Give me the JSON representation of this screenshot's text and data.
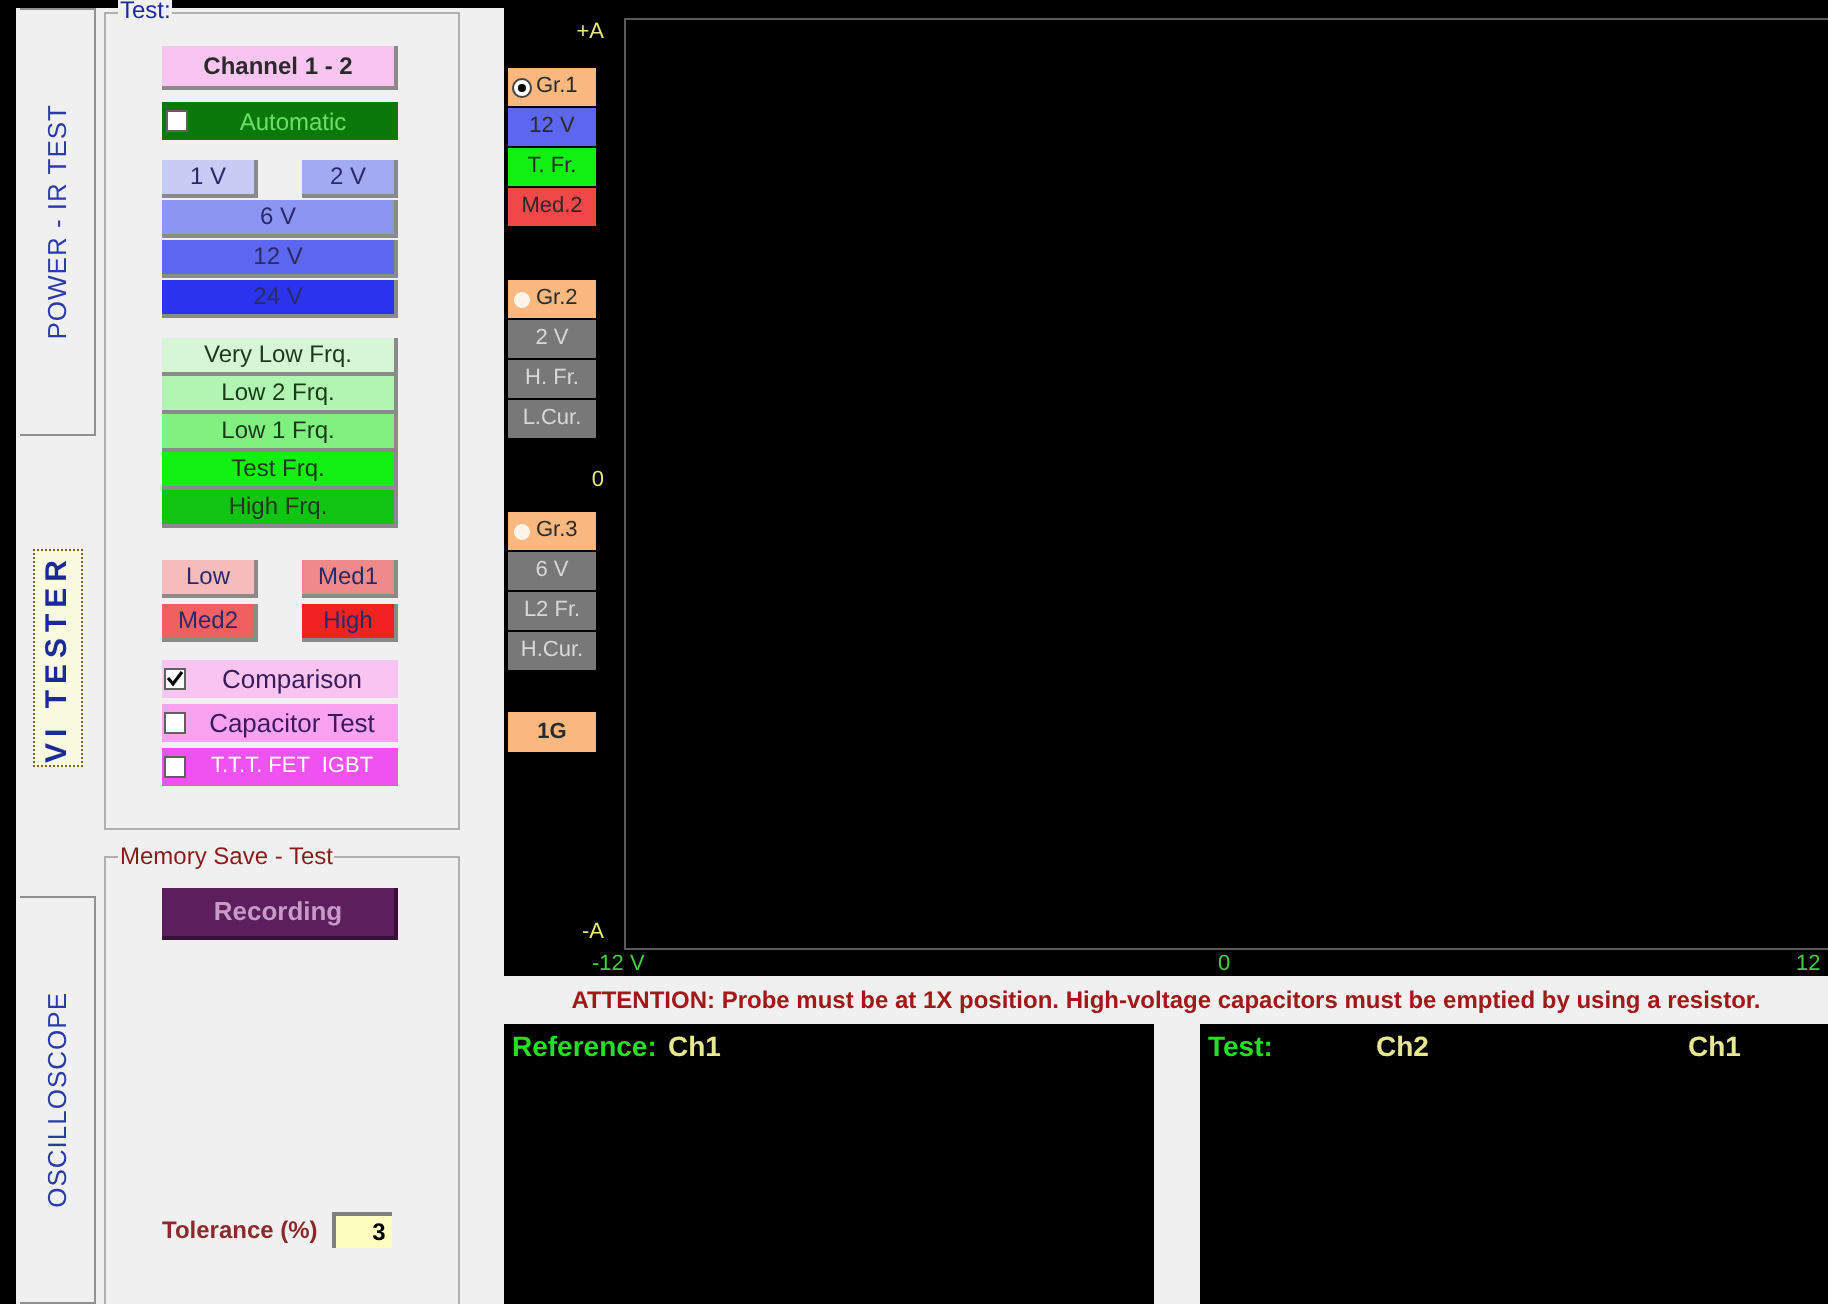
{
  "tabs": [
    {
      "label": "POWER - IR TEST",
      "selected": false
    },
    {
      "label": "VI TESTER",
      "selected": true
    },
    {
      "label": "OSCILLOSCOPE",
      "selected": false
    }
  ],
  "test_group": {
    "title": "Test:",
    "channel_button": "Channel 1 - 2",
    "automatic": {
      "label": "Automatic",
      "checked": false
    },
    "voltage_rows": [
      [
        {
          "label": "1 V",
          "color": "#c8ccf4"
        },
        {
          "label": "2 V",
          "color": "#a2aaf2"
        }
      ],
      [
        {
          "label": "6 V",
          "color": "#8c96f2"
        }
      ],
      [
        {
          "label": "12 V",
          "color": "#5c66ee"
        }
      ],
      [
        {
          "label": "24 V",
          "color": "#2a34ee"
        }
      ]
    ],
    "frequency_buttons": [
      {
        "label": "Very Low Frq.",
        "color": "#d6f6d6"
      },
      {
        "label": "Low 2 Frq.",
        "color": "#b2f4b2"
      },
      {
        "label": "Low 1 Frq.",
        "color": "#80f080"
      },
      {
        "label": "Test Frq.",
        "color": "#12f012"
      },
      {
        "label": "High Frq.",
        "color": "#12c412"
      }
    ],
    "current_rows": [
      [
        {
          "label": "Low",
          "color": "#f6bcbc"
        },
        {
          "label": "Med1",
          "color": "#f08a8a"
        }
      ],
      [
        {
          "label": "Med2",
          "color": "#f06060"
        },
        {
          "label": "High",
          "color": "#f02222"
        }
      ]
    ],
    "options": [
      {
        "label": "Comparison",
        "checked": true,
        "color": "#f8c4f0"
      },
      {
        "label": "Capacitor Test",
        "checked": false,
        "color": "#f8a2f0"
      },
      {
        "label": "T.T.T. FET  IGBT",
        "checked": false,
        "color": "#f052f0"
      }
    ]
  },
  "memory_group": {
    "title": "Memory Save - Test",
    "recording_button": "Recording",
    "tolerance_label": "Tolerance (%)",
    "tolerance_value": "3"
  },
  "plot": {
    "y_labels": [
      "+A",
      "0",
      "-A"
    ],
    "x_labels": [
      "-12 V",
      "0",
      "12"
    ],
    "groups": [
      {
        "label": "Gr.1",
        "selected": true,
        "settings": [
          {
            "label": "12 V",
            "color": "#5c66ee"
          },
          {
            "label": "T. Fr.",
            "color": "#12f012"
          },
          {
            "label": "Med.2",
            "color": "#f04848"
          }
        ]
      },
      {
        "label": "Gr.2",
        "selected": false,
        "settings": [
          {
            "label": "2 V",
            "color": "#787878"
          },
          {
            "label": "H. Fr.",
            "color": "#787878"
          },
          {
            "label": "L.Cur.",
            "color": "#787878"
          }
        ]
      },
      {
        "label": "Gr.3",
        "selected": false,
        "settings": [
          {
            "label": "6 V",
            "color": "#787878"
          },
          {
            "label": "L2 Fr.",
            "color": "#787878"
          },
          {
            "label": "H.Cur.",
            "color": "#787878"
          }
        ]
      }
    ],
    "gain_button": "1G"
  },
  "attention": "ATTENTION: Probe must be at 1X position. High-voltage capacitors must be emptied by using a resistor.",
  "reference_panel": {
    "label": "Reference:",
    "channel": "Ch1"
  },
  "test_panel": {
    "label": "Test:",
    "channels": [
      "Ch2",
      "Ch1"
    ]
  }
}
